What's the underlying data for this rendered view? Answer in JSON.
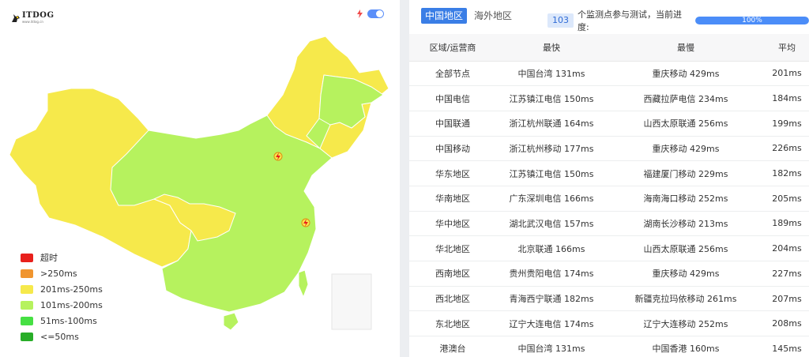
{
  "logo": {
    "name": "ITDOG",
    "subtext": "www.itdog.cn"
  },
  "map": {
    "toggle_on": true,
    "colors": {
      "timeout": "#e8201c",
      "over250": "#f0952f",
      "ms201_250": "#f6e94b",
      "ms101_200": "#b6f25e",
      "ms51_100": "#46e043",
      "le50": "#28ad28"
    },
    "legend": [
      {
        "label": "超时",
        "color": "#e8201c"
      },
      {
        "label": ">250ms",
        "color": "#f0952f"
      },
      {
        "label": "201ms-250ms",
        "color": "#f6e94b"
      },
      {
        "label": "101ms-200ms",
        "color": "#b6f25e"
      },
      {
        "label": "51ms-100ms",
        "color": "#46e043"
      },
      {
        "label": "<=50ms",
        "color": "#28ad28"
      }
    ]
  },
  "tabs": [
    {
      "label": "中国地区",
      "active": true
    },
    {
      "label": "海外地区",
      "active": false
    }
  ],
  "progress": {
    "node_count": "103",
    "text": "个监测点参与测试，当前进度:",
    "percent_label": "100%",
    "percent": 100
  },
  "table": {
    "headers": [
      "区域/运营商",
      "最快",
      "最慢",
      "平均"
    ],
    "rows": [
      [
        "全部节点",
        "中国台湾 131ms",
        "重庆移动 429ms",
        "201ms"
      ],
      [
        "中国电信",
        "江苏镇江电信 150ms",
        "西藏拉萨电信 234ms",
        "184ms"
      ],
      [
        "中国联通",
        "浙江杭州联通 164ms",
        "山西太原联通 256ms",
        "199ms"
      ],
      [
        "中国移动",
        "浙江杭州移动 177ms",
        "重庆移动 429ms",
        "226ms"
      ],
      [
        "华东地区",
        "江苏镇江电信 150ms",
        "福建厦门移动 229ms",
        "182ms"
      ],
      [
        "华南地区",
        "广东深圳电信 166ms",
        "海南海口移动 252ms",
        "205ms"
      ],
      [
        "华中地区",
        "湖北武汉电信 157ms",
        "湖南长沙移动 213ms",
        "189ms"
      ],
      [
        "华北地区",
        "北京联通 166ms",
        "山西太原联通 256ms",
        "204ms"
      ],
      [
        "西南地区",
        "贵州贵阳电信 174ms",
        "重庆移动 429ms",
        "227ms"
      ],
      [
        "西北地区",
        "青海西宁联通 182ms",
        "新疆克拉玛依移动 261ms",
        "207ms"
      ],
      [
        "东北地区",
        "辽宁大连电信 174ms",
        "辽宁大连移动 252ms",
        "208ms"
      ],
      [
        "港澳台",
        "中国台湾 131ms",
        "中国香港 160ms",
        "145ms"
      ]
    ]
  }
}
